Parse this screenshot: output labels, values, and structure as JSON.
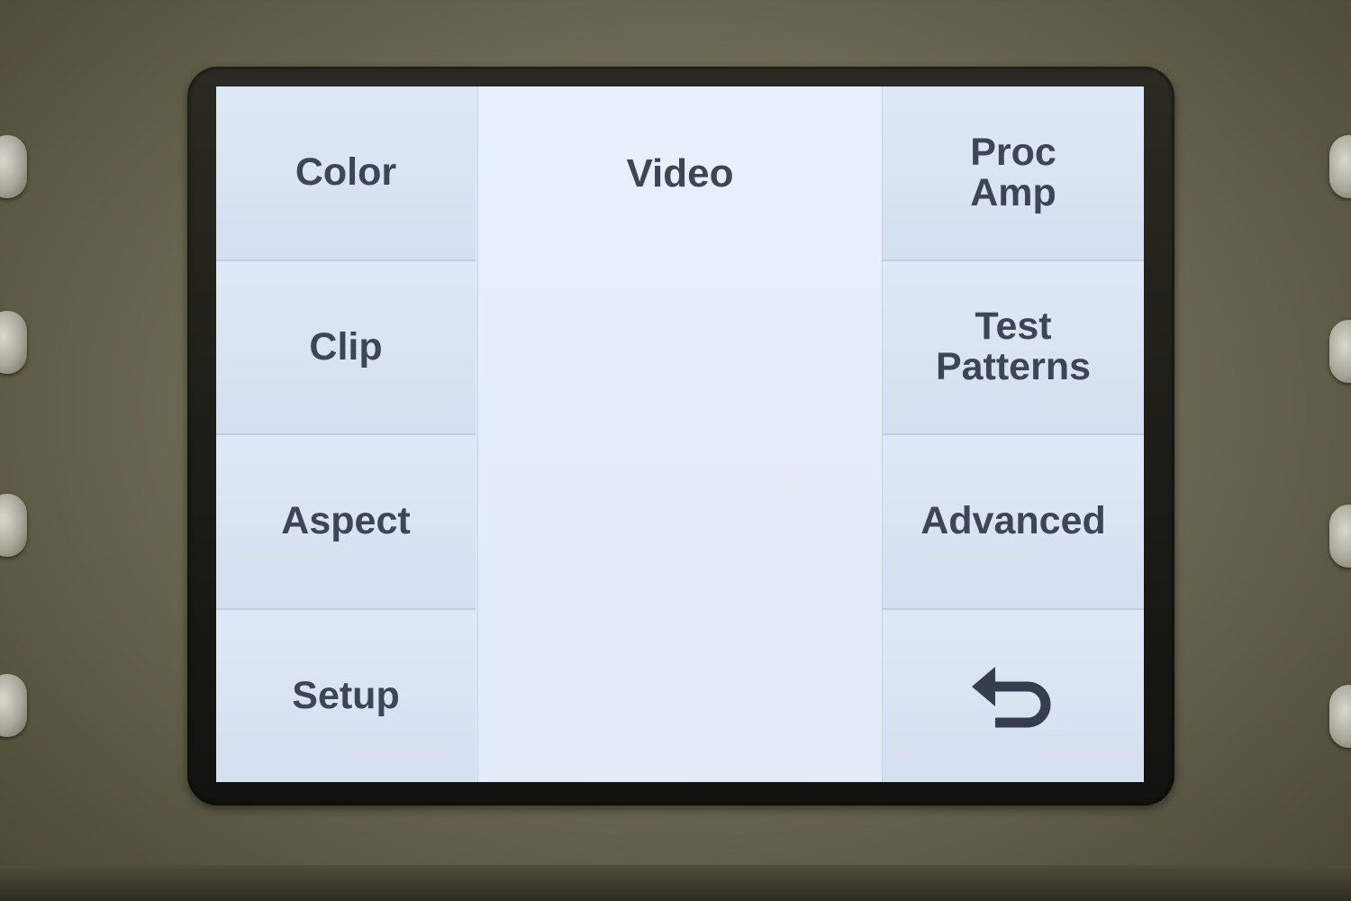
{
  "screen": {
    "title": "Video",
    "left_menu": [
      {
        "label": "Color"
      },
      {
        "label": "Clip"
      },
      {
        "label": "Aspect"
      },
      {
        "label": "Setup"
      }
    ],
    "right_menu": [
      {
        "label": "Proc\nAmp"
      },
      {
        "label": "Test\nPatterns"
      },
      {
        "label": "Advanced"
      },
      {
        "icon": "back-arrow-icon"
      }
    ]
  },
  "colors": {
    "screen_background": "#dde7f6",
    "text": "#3e4556",
    "device_body": "#6f6c57"
  }
}
